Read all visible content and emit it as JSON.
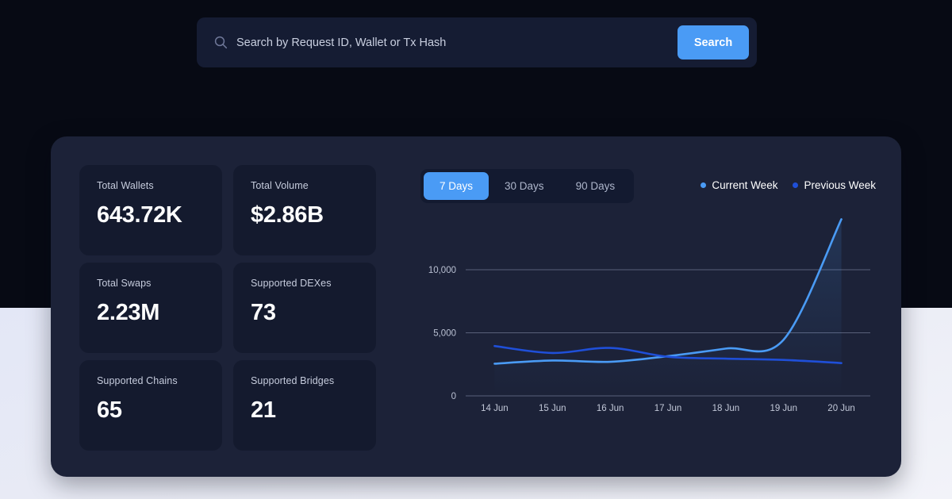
{
  "search": {
    "placeholder": "Search by Request ID, Wallet or Tx Hash",
    "value": "",
    "button_label": "Search",
    "icon": "search-icon"
  },
  "stats": [
    {
      "label": "Total Wallets",
      "value": "643.72K"
    },
    {
      "label": "Total Volume",
      "value": "$2.86B"
    },
    {
      "label": "Total Swaps",
      "value": "2.23M"
    },
    {
      "label": "Supported DEXes",
      "value": "73"
    },
    {
      "label": "Supported Chains",
      "value": "65"
    },
    {
      "label": "Supported Bridges",
      "value": "21"
    }
  ],
  "range_tabs": [
    {
      "label": "7 Days",
      "active": true
    },
    {
      "label": "30 Days",
      "active": false
    },
    {
      "label": "90 Days",
      "active": false
    }
  ],
  "legend": [
    {
      "label": "Current Week",
      "color": "#4a9bf5"
    },
    {
      "label": "Previous Week",
      "color": "#1f4fd8"
    }
  ],
  "colors": {
    "accent": "#4a9bf5",
    "current_week": "#4a9bf5",
    "previous_week": "#1f4fd8",
    "panel_bg": "#1c2238",
    "card_bg": "#141a2e",
    "page_dark": "#070a14",
    "page_light": "#e8eaf6"
  },
  "chart_data": {
    "type": "line",
    "title": "",
    "xlabel": "",
    "ylabel": "",
    "categories": [
      "14 Jun",
      "15 Jun",
      "16 Jun",
      "17 Jun",
      "18 Jun",
      "19 Jun",
      "20 Jun"
    ],
    "ytick_labels": [
      "0",
      "5,000",
      "10,000"
    ],
    "yticks": [
      0,
      5000,
      10000
    ],
    "ylim": [
      0,
      14400
    ],
    "grid": true,
    "legend_position": "top-right",
    "series": [
      {
        "name": "Current Week",
        "color": "#4a9bf5",
        "values": [
          2550,
          2800,
          2700,
          3150,
          3750,
          4450,
          14000
        ]
      },
      {
        "name": "Previous Week",
        "color": "#1f4fd8",
        "values": [
          3950,
          3400,
          3800,
          3100,
          2950,
          2850,
          2600
        ]
      }
    ]
  }
}
